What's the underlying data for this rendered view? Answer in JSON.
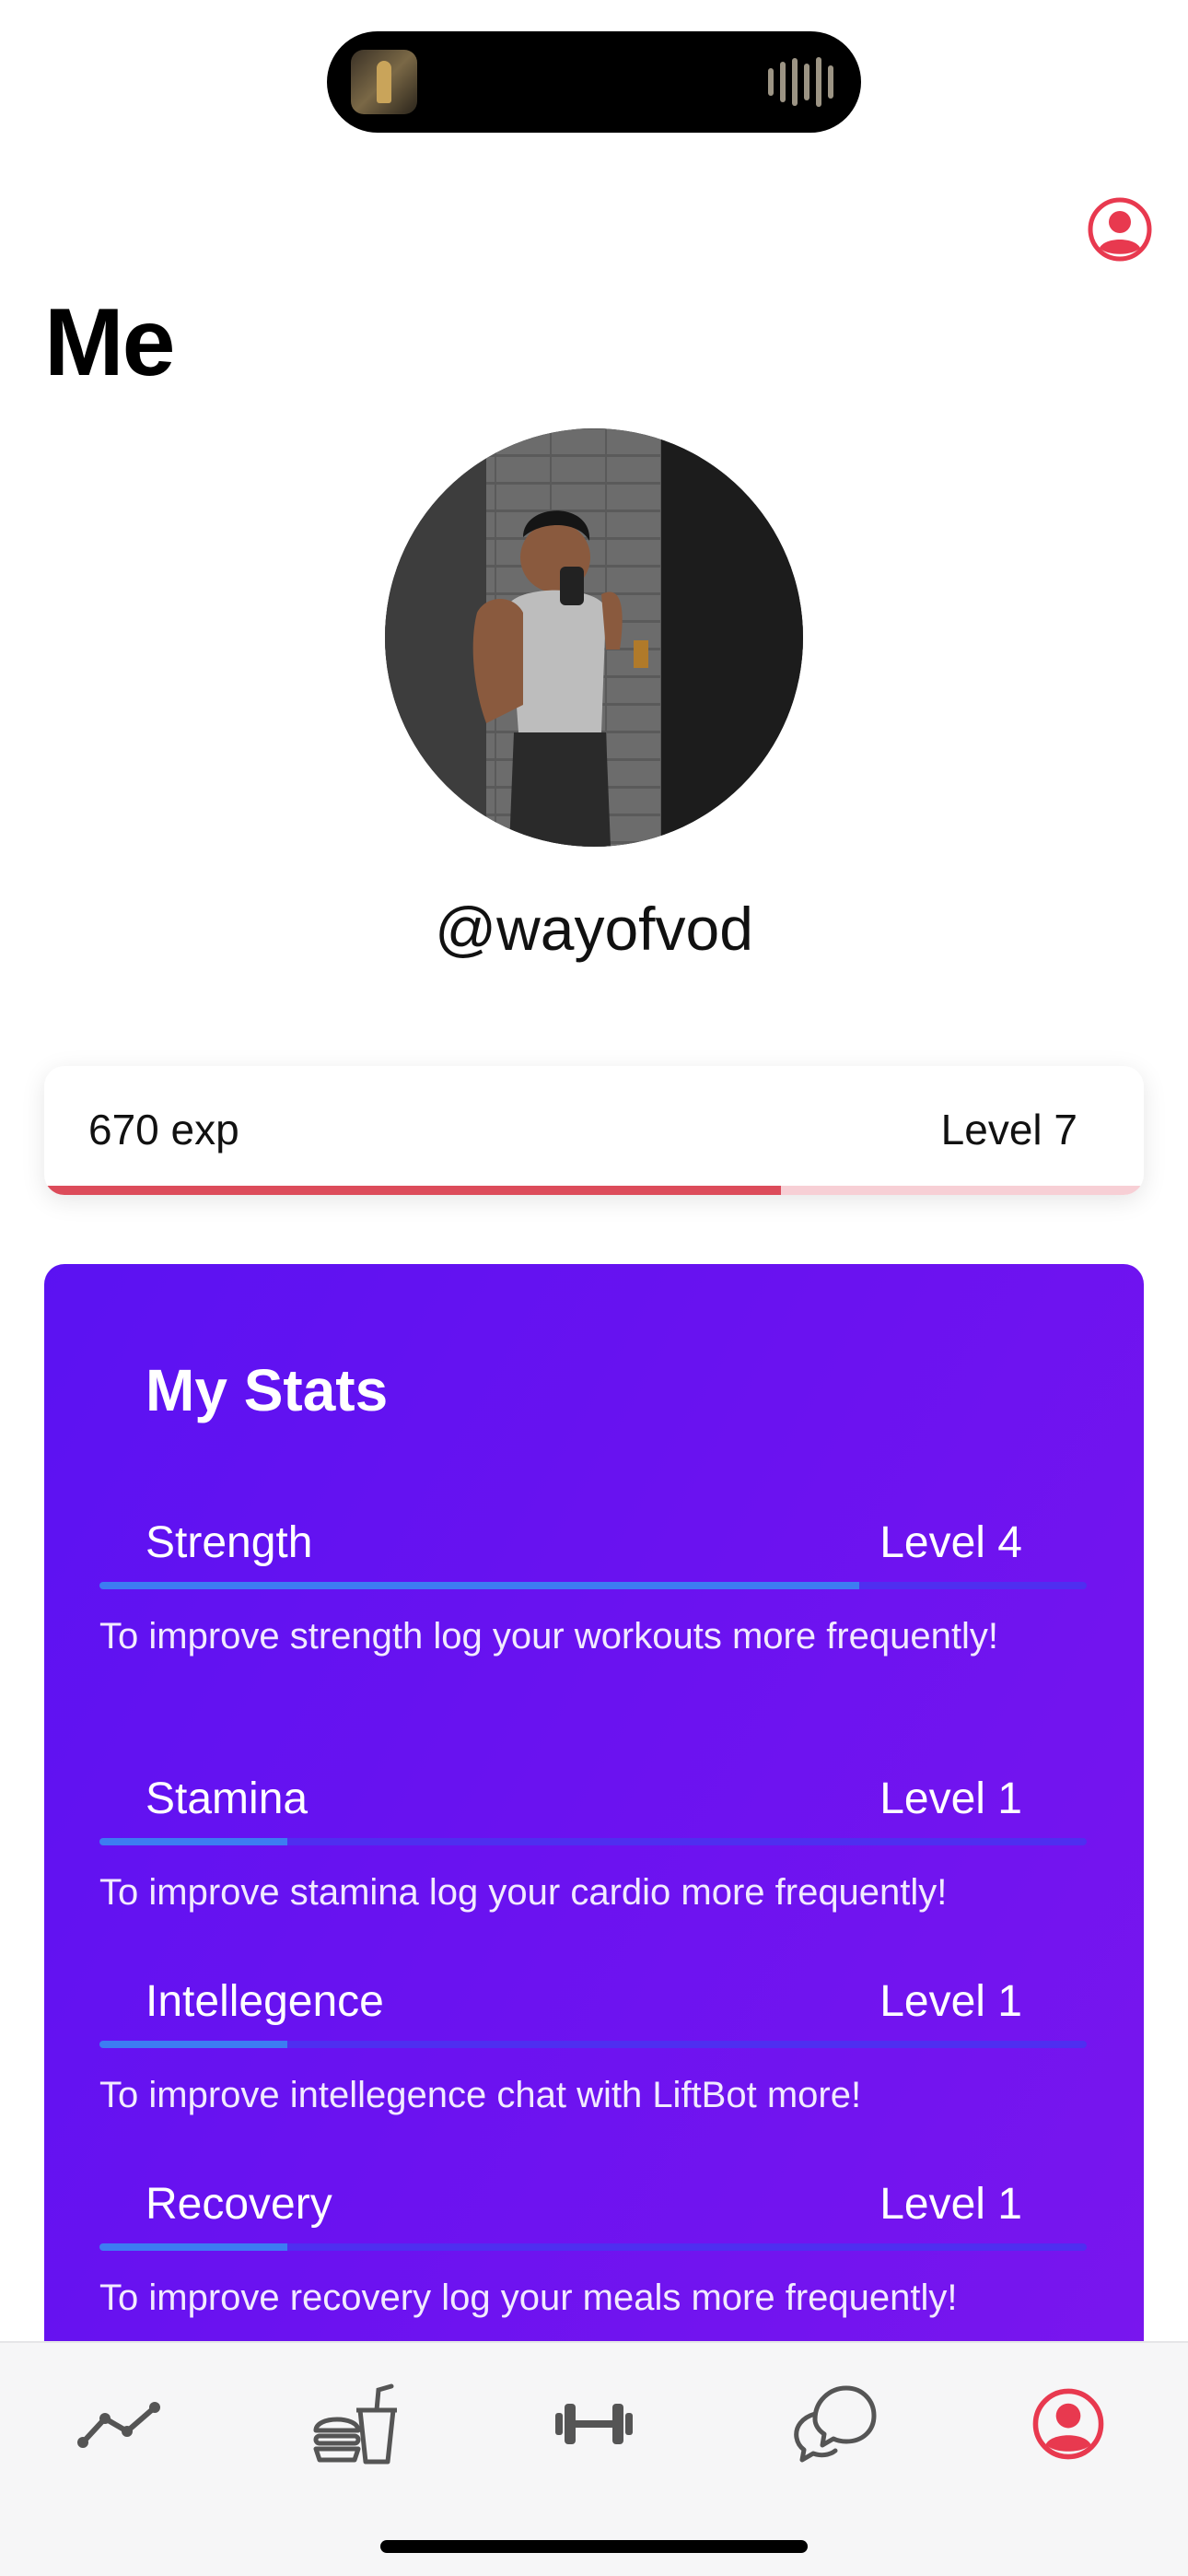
{
  "header": {
    "title": "Me",
    "profile_icon": "person-circle-icon"
  },
  "profile": {
    "username": "@wayofvod",
    "avatar": "profile-photo"
  },
  "experience": {
    "exp_label": "670 exp",
    "level_label": "Level 7",
    "progress": 0.67,
    "fill_color": "#dc4b5a",
    "track_color": "#f7cfd5"
  },
  "stats": {
    "title": "My Stats",
    "items": [
      {
        "name": "Strength",
        "level": "Level 4",
        "progress": 0.77,
        "hint": "To improve strength log your workouts more frequently!"
      },
      {
        "name": "Stamina",
        "level": "Level 1",
        "progress": 0.19,
        "hint": "To improve stamina log your cardio more frequently!"
      },
      {
        "name": "Intellegence",
        "level": "Level 1",
        "progress": 0.19,
        "hint": "To improve intellegence chat with LiftBot more!"
      },
      {
        "name": "Recovery",
        "level": "Level 1",
        "progress": 0.19,
        "hint": "To improve recovery log your meals more frequently!"
      }
    ]
  },
  "tabbar": {
    "tabs": [
      {
        "icon": "chart-line-icon",
        "active": false
      },
      {
        "icon": "meal-icon",
        "active": false
      },
      {
        "icon": "dumbbell-icon",
        "active": false
      },
      {
        "icon": "chat-bubbles-icon",
        "active": false
      },
      {
        "icon": "person-circle-icon",
        "active": true
      }
    ],
    "active_color": "#e8394f",
    "inactive_color": "#555555"
  }
}
